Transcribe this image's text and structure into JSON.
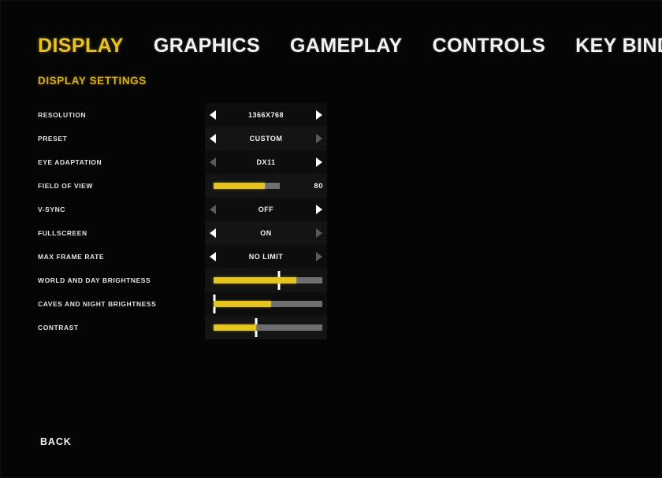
{
  "nav": {
    "tabs": [
      {
        "label": "DISPLAY",
        "active": true
      },
      {
        "label": "GRAPHICS",
        "active": false
      },
      {
        "label": "GAMEPLAY",
        "active": false
      },
      {
        "label": "CONTROLS",
        "active": false
      },
      {
        "label": "KEY BINDING",
        "active": false
      }
    ]
  },
  "section": {
    "title": "DISPLAY SETTINGS"
  },
  "colors": {
    "accent": "#e8c227",
    "accent_dim": "#d4ad1f",
    "slider_fill": "#e5c320",
    "slider_track": "#6f6f6f",
    "text": "#f0f0f0",
    "background": "#050505"
  },
  "settings": [
    {
      "label": "RESOLUTION",
      "type": "selector",
      "value": "1366x768",
      "left_arrow": "enabled",
      "right_arrow": "enabled"
    },
    {
      "label": "PRESET",
      "type": "selector",
      "value": "CUSTOM",
      "left_arrow": "enabled",
      "right_arrow": "disabled"
    },
    {
      "label": "EYE ADAPTATION",
      "type": "selector",
      "value": "DX11",
      "left_arrow": "disabled",
      "right_arrow": "enabled"
    },
    {
      "label": "FIELD OF VIEW",
      "type": "slider",
      "value": "80",
      "fill_percent": 60,
      "track_percent": 78,
      "tick_percent": null,
      "show_value": true
    },
    {
      "label": "V-SYNC",
      "type": "selector",
      "value": "OFF",
      "left_arrow": "disabled",
      "right_arrow": "enabled"
    },
    {
      "label": "FULLSCREEN",
      "type": "selector",
      "value": "ON",
      "left_arrow": "enabled",
      "right_arrow": "disabled"
    },
    {
      "label": "MAX FRAME RATE",
      "type": "selector",
      "value": "NO LIMIT",
      "left_arrow": "enabled",
      "right_arrow": "disabled"
    },
    {
      "label": "WORLD AND DAY BRIGHTNESS",
      "type": "slider",
      "value": "",
      "fill_percent": 76,
      "track_percent": 100,
      "tick_percent": 60,
      "show_value": false
    },
    {
      "label": "CAVES AND NIGHT BRIGHTNESS",
      "type": "slider",
      "value": "",
      "fill_percent": 53,
      "track_percent": 100,
      "tick_percent": 1,
      "show_value": false
    },
    {
      "label": "CONTRAST",
      "type": "slider",
      "value": "",
      "fill_percent": 39,
      "track_percent": 100,
      "tick_percent": 39,
      "show_value": false
    }
  ],
  "footer": {
    "back_label": "BACK"
  }
}
